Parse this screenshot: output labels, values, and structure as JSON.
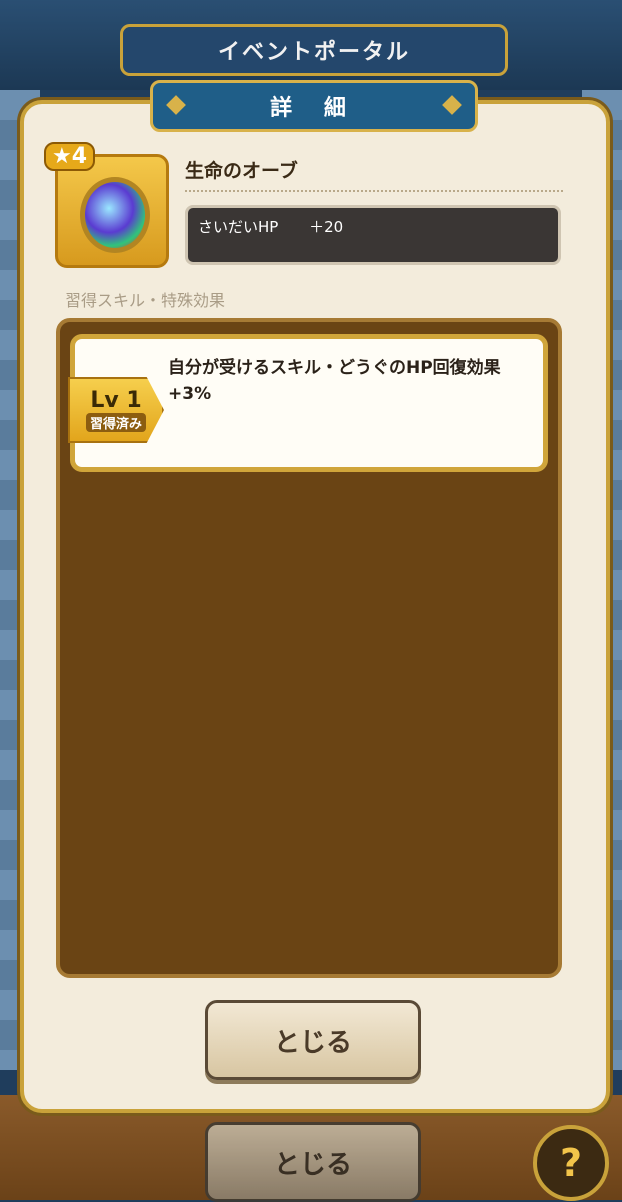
{
  "app": {
    "title": "イベントポータル"
  },
  "dialog": {
    "header": "詳 細",
    "item": {
      "rarity": "4",
      "name": "生命のオーブ",
      "stat_label": "さいだいHP",
      "stat_value": "＋20",
      "icon": "orb-icon"
    },
    "section_title": "習得スキル・特殊効果",
    "skills": [
      {
        "level": "Lv 1",
        "status": "習得済み",
        "description": "自分が受けるスキル・どうぐのHP回復効果 +3%"
      }
    ],
    "close_label": "とじる"
  },
  "background": {
    "close_label": "とじる",
    "help_label": "?"
  },
  "colors": {
    "accent": "#c9a23a",
    "header_blue": "#1f5e88",
    "panel_brown": "#6a4414"
  }
}
